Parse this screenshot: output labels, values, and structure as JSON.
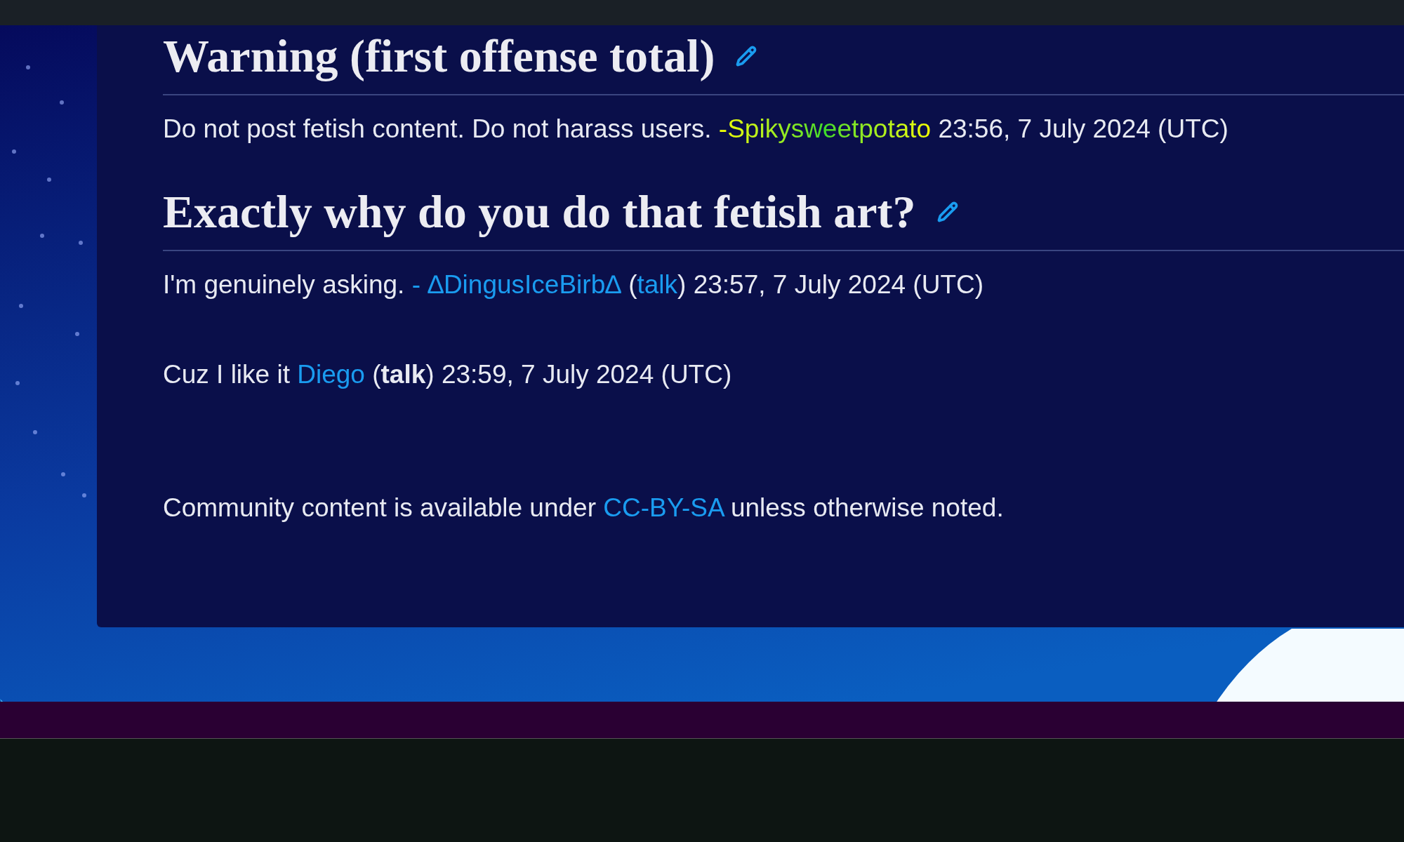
{
  "sections": [
    {
      "heading": "Warning (first offense total)",
      "posts": [
        {
          "segments": [
            {
              "kind": "plain",
              "text": "Do not post fetish content. Do not harass users. "
            },
            {
              "kind": "gradient",
              "text": "-Spikysweetpotato"
            },
            {
              "kind": "plain",
              "text": " 23:56, 7 July 2024 (UTC)"
            }
          ]
        }
      ]
    },
    {
      "heading": "Exactly why do you do that fetish art?",
      "posts": [
        {
          "segments": [
            {
              "kind": "plain",
              "text": "I'm genuinely asking. "
            },
            {
              "kind": "link",
              "text": "- ∆DingusIceBirb∆"
            },
            {
              "kind": "plain",
              "text": " ("
            },
            {
              "kind": "link",
              "text": "talk"
            },
            {
              "kind": "plain",
              "text": ") 23:57, 7 July 2024 (UTC)"
            }
          ]
        },
        {
          "segments": [
            {
              "kind": "plain",
              "text": "Cuz I like it "
            },
            {
              "kind": "link",
              "text": "Diego"
            },
            {
              "kind": "plain",
              "text": " ("
            },
            {
              "kind": "bold",
              "text": "talk"
            },
            {
              "kind": "plain",
              "text": ") 23:59, 7 July 2024 (UTC)"
            }
          ]
        }
      ]
    }
  ],
  "footer": {
    "segments": [
      {
        "kind": "plain",
        "text": "Community content is available under "
      },
      {
        "kind": "link",
        "text": "CC-BY-SA"
      },
      {
        "kind": "plain",
        "text": " unless otherwise noted."
      }
    ]
  }
}
